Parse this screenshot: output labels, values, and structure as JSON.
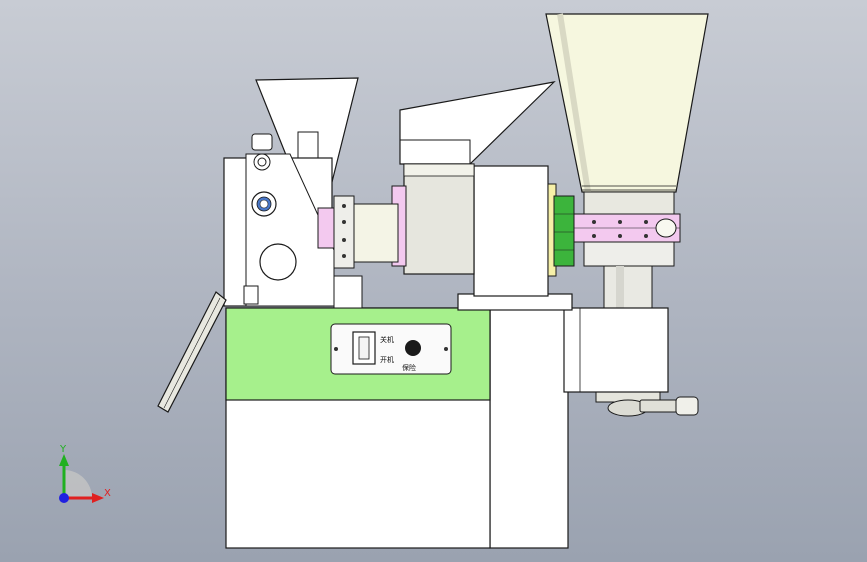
{
  "viewport": {
    "colors": {
      "background_top": "#c8ccd4",
      "background_bottom": "#9aa2b0",
      "body_fill": "#ffffff",
      "panel_band": "#a6f08c",
      "cone_fill": "#f6f7df",
      "collar_pink": "#f3c9ef",
      "ring_green": "#3cb43c",
      "metal_fill": "#e4e4dc",
      "outline": "#1a1a1a"
    }
  },
  "control_panel": {
    "label_top": "关机",
    "label_mid": "开机",
    "label_bottom": "保险"
  },
  "triad": {
    "x_label": "X",
    "y_label": "Y",
    "x_color": "#e02020",
    "y_color": "#20b020",
    "z_color": "#2020e0"
  }
}
